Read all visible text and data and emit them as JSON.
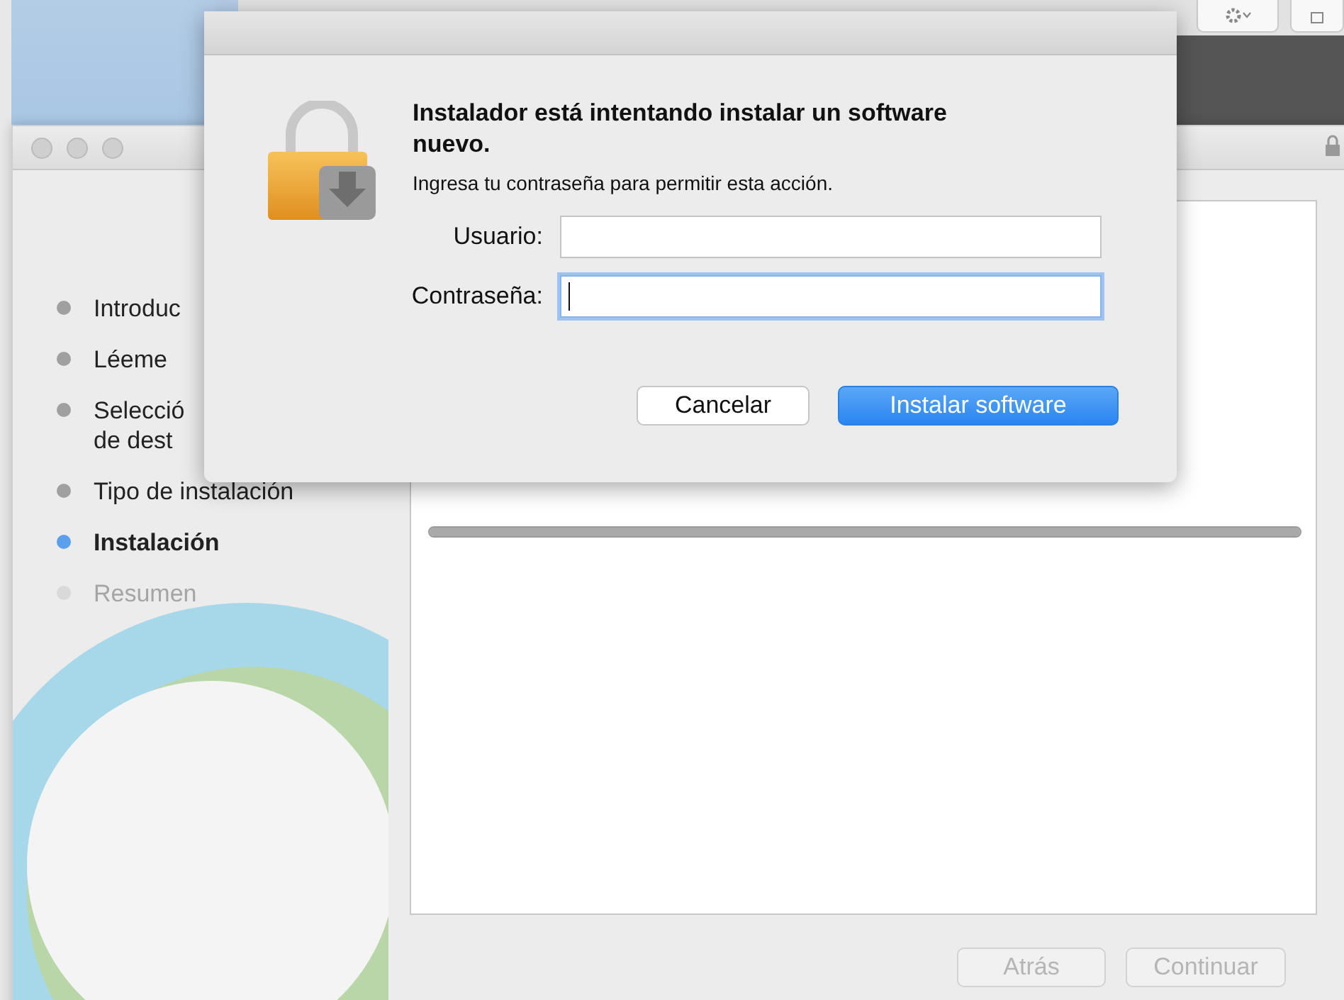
{
  "installer": {
    "steps": [
      {
        "label": "Introduc",
        "pending": false,
        "selected": false
      },
      {
        "label": "Léeme",
        "pending": false,
        "selected": false
      },
      {
        "label": "Selecció\nde dest",
        "pending": false,
        "selected": false
      },
      {
        "label": "Tipo de instalación",
        "pending": false,
        "selected": false
      },
      {
        "label": "Instalación",
        "pending": false,
        "selected": true
      },
      {
        "label": "Resumen",
        "pending": true,
        "selected": false
      }
    ],
    "progress": {
      "level": 1
    },
    "buttons": [
      {
        "label": "Atrás",
        "disabled": true
      },
      {
        "label": "Continuar",
        "disabled": true
      }
    ]
  },
  "dialog": {
    "title": "Instalador está intentando instalar un software nuevo.",
    "message": "Ingresa tu contraseña para permitir esta acción.",
    "fields": [
      {
        "label": "Usuario:",
        "focused": false
      },
      {
        "label": "Contraseña:",
        "focused": true
      }
    ],
    "buttons": [
      {
        "label": "Cancelar",
        "default": false
      },
      {
        "label": "Instalar software",
        "default": true
      }
    ]
  }
}
